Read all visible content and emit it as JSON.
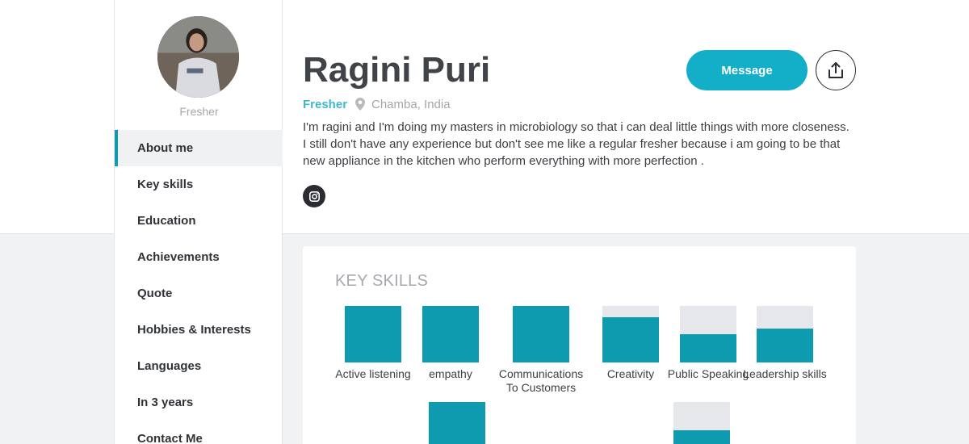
{
  "profile": {
    "name": "Ragini Puri",
    "avatar_caption": "Fresher",
    "role": "Fresher",
    "location": "Chamba, India",
    "bio": "I'm ragini and I'm doing my masters in microbiology so that i can deal little things with more closeness. I still don't have any experience but don't see me like a regular fresher because i am going to be that new appliance in the kitchen who perform everything with more perfection .",
    "social_icon": "instagram-icon"
  },
  "actions": {
    "message_label": "Message",
    "share_icon": "share-icon"
  },
  "sidebar": {
    "items": [
      {
        "label": "About me",
        "active": true
      },
      {
        "label": "Key skills",
        "active": false
      },
      {
        "label": "Education",
        "active": false
      },
      {
        "label": "Achievements",
        "active": false
      },
      {
        "label": "Quote",
        "active": false
      },
      {
        "label": "Hobbies & Interests",
        "active": false
      },
      {
        "label": "Languages",
        "active": false
      },
      {
        "label": "In 3 years",
        "active": false
      },
      {
        "label": "Contact Me",
        "active": false
      }
    ]
  },
  "key_skills": {
    "title": "KEY SKILLS",
    "skills": [
      {
        "name": "Active listening",
        "level": 1.0
      },
      {
        "name": "empathy",
        "level": 1.0
      },
      {
        "name": "Communications To Customers",
        "level": 1.0
      },
      {
        "name": "Creativity",
        "level": 0.8
      },
      {
        "name": "Public Speaking",
        "level": 0.5
      },
      {
        "name": "Leadership skills",
        "level": 0.6
      },
      {
        "name": "",
        "level": 1.0
      },
      {
        "name": "",
        "level": 0.5
      }
    ]
  },
  "colors": {
    "accent": "#13aec8",
    "skill_fill": "#0e9aaf",
    "skill_empty": "#e6e7ea",
    "muted_text": "#a3a6ab"
  }
}
